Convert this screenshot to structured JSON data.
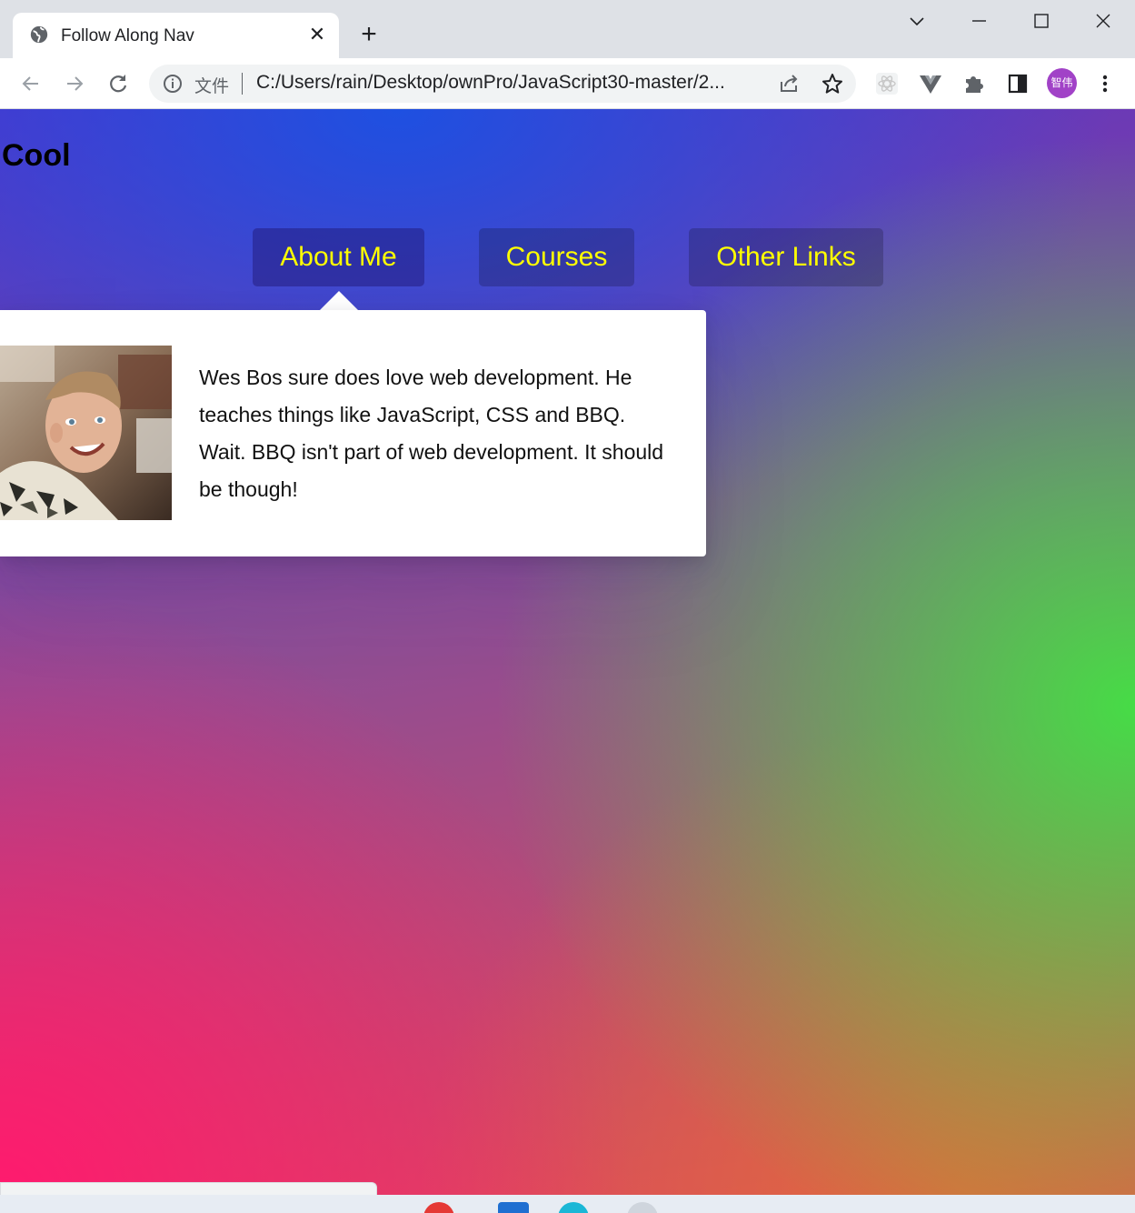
{
  "browser": {
    "tab_title": "Follow Along Nav",
    "tab_close": "✕",
    "new_tab": "+",
    "address_file_label": "文件",
    "address_url": "C:/Users/rain/Desktop/ownPro/JavaScript30-master/2...",
    "profile_label": "智伟",
    "profile_color": "#a142c7"
  },
  "page": {
    "heading": "Cool",
    "nav": [
      {
        "label": "About Me"
      },
      {
        "label": "Courses"
      },
      {
        "label": "Other Links"
      }
    ],
    "nav_text_color": "#ffff00",
    "dropdown": {
      "photo_alt": "Wes Bos portrait",
      "bio": "Wes Bos sure does love web development. He teaches things like JavaScript, CSS and BBQ. Wait. BBQ isn't part of web development. It should be though!"
    }
  },
  "icons": {
    "tab": "globe-icon",
    "back": "arrow-left-icon",
    "forward": "arrow-right-icon",
    "reload": "reload-icon",
    "info": "info-icon",
    "share": "share-icon",
    "bookmark": "star-icon",
    "extensions": "puzzle-icon",
    "sidepanel": "side-panel-icon",
    "menu": "kebab-menu-icon"
  }
}
